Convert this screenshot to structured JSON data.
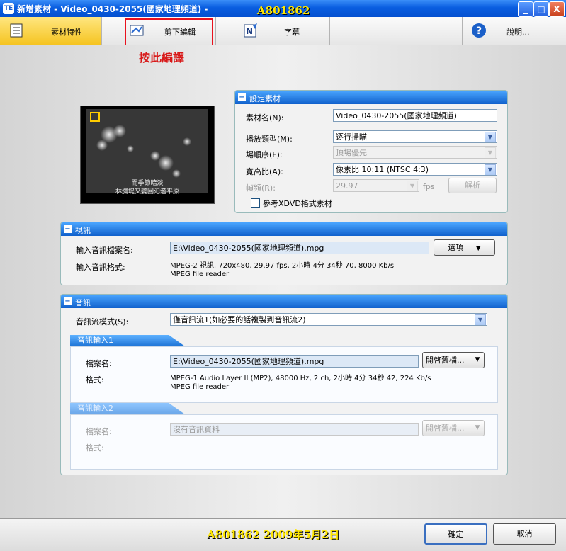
{
  "window": {
    "title": "新增素材 - Video_0430-2055(國家地理頻道) -",
    "icon_text": "TE",
    "minimize": "_",
    "maximize": "□",
    "close": "X"
  },
  "watermark_top": "A801862",
  "tabs": [
    {
      "label": "素材特性",
      "active": true
    },
    {
      "label": "剪下編輯",
      "active": false
    },
    {
      "label": "字幕",
      "active": false
    },
    {
      "label": "說明...",
      "active": false
    }
  ],
  "annotation": "按此編譯",
  "preview": {
    "caption_line1": "而季節暗淡",
    "caption_line2": "林瀰堤又變回氾濫平原"
  },
  "settings": {
    "header": "設定素材",
    "name_label": "素材名(N):",
    "name_value": "Video_0430-2055(國家地理頻道)",
    "playback_label": "播放類型(M):",
    "playback_value": "逐行掃瞄",
    "field_order_label": "場順序(F):",
    "field_order_value": "頂場優先",
    "aspect_label": "寬高比(A):",
    "aspect_value": "像素比 10:11 (NTSC 4:3)",
    "framerate_label": "幀頻(R):",
    "framerate_value": "29.97",
    "fps_unit": "fps",
    "analyze_button": "解析",
    "xdvd_label": "參考XDVD格式素材"
  },
  "video": {
    "header": "視訊",
    "file_label": "輸入音訊檔案名:",
    "file_value": "E:\\Video_0430-2055(國家地理頻道).mpg",
    "options_button": "選項",
    "format_label": "輸入音訊格式:",
    "format_line1": "MPEG-2 視訊, 720x480, 29.97 fps, 2小時 4分 34秒 70, 8000 Kb/s",
    "format_line2": "MPEG file reader"
  },
  "audio": {
    "header": "音訊",
    "stream_mode_label": "音訊流模式(S):",
    "stream_mode_value": "僅音訊流1(如必要的話複製到音訊流2)",
    "input1": {
      "header": "音訊輸入1",
      "file_label": "檔案名:",
      "file_value": "E:\\Video_0430-2055(國家地理頻道).mpg",
      "open_button": "開啓舊檔...",
      "format_label": "格式:",
      "format_line1": "MPEG-1 Audio Layer II (MP2), 48000 Hz, 2 ch, 2小時 4分 34秒 42, 224 Kb/s",
      "format_line2": "MPEG file reader"
    },
    "input2": {
      "header": "音訊輸入2",
      "file_label": "檔案名:",
      "file_value": "沒有音訊資料",
      "open_button": "開啓舊檔...",
      "format_label": "格式:"
    }
  },
  "footer": {
    "watermark": "A801862   2009年5月2日",
    "ok_button": "確定",
    "cancel_button": "取消"
  }
}
